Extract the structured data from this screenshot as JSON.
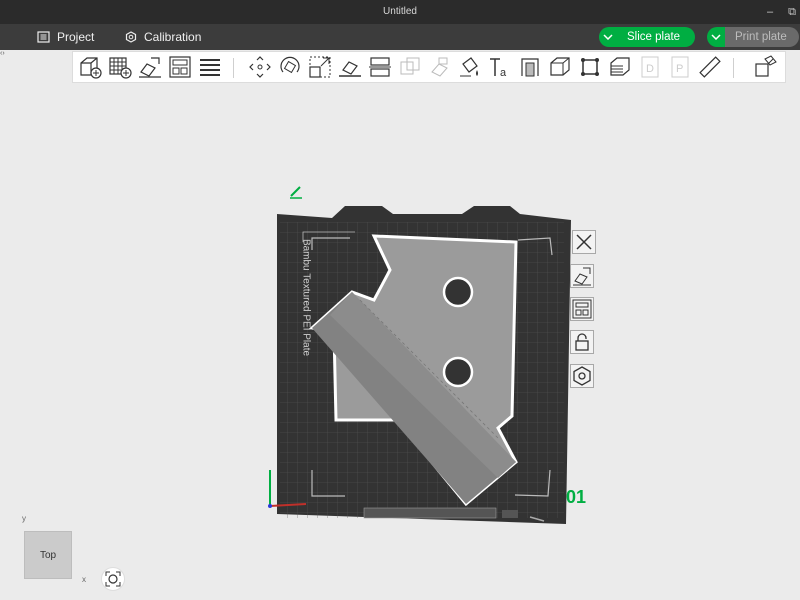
{
  "window": {
    "title": "Untitled"
  },
  "menubar": {
    "project_label": "Project",
    "calibration_label": "Calibration",
    "slice_label": "Slice plate",
    "print_label": "Print plate"
  },
  "toolbar": {
    "tools": [
      "add-object-icon",
      "add-plate-icon",
      "auto-orient-icon",
      "arrange-icon",
      "layers-icon",
      "move-icon",
      "rotate-icon",
      "scale-icon",
      "lay-on-face-icon",
      "cut-icon",
      "boolean-icon",
      "support-paint-icon",
      "color-paint-icon",
      "text-icon",
      "emboss-icon",
      "seam-icon",
      "assembly-icon",
      "measure-icon",
      "slice-view-icon",
      "variable-layer-icon",
      "disabled-d-icon",
      "disabled-p-icon",
      "ruler-icon",
      "split-icon"
    ]
  },
  "plate": {
    "label": "Bambu Textured PEI Plate",
    "number": "01",
    "side_tools": [
      "close-icon",
      "orient-plate-icon",
      "arrange-plate-icon",
      "lock-icon",
      "settings-icon"
    ]
  },
  "view_cube": {
    "label": "Top",
    "x_label": "x",
    "y_label": "y"
  },
  "colors": {
    "accent": "#00ae42",
    "plate": "#333333",
    "model": "#9b9b9b"
  }
}
